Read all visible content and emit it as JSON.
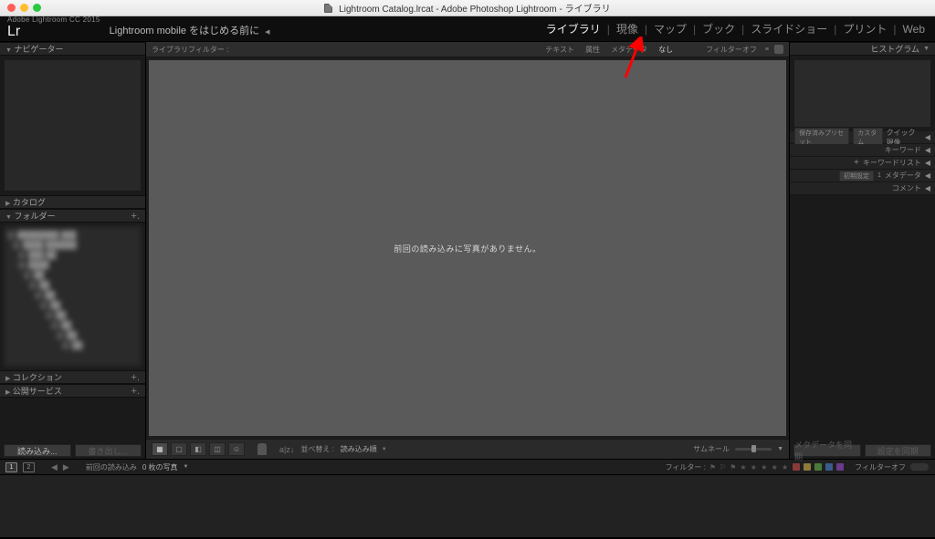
{
  "mac": {
    "title": "Lightroom Catalog.lrcat - Adobe Photoshop Lightroom - ライブラリ"
  },
  "topbar": {
    "edition": "Adobe Lightroom CC 2015",
    "logo": "Lr",
    "tagline": "Lightroom mobile をはじめる前に",
    "triangle": "◀"
  },
  "modules": {
    "library": "ライブラリ",
    "develop": "現像",
    "map": "マップ",
    "book": "ブック",
    "slideshow": "スライドショー",
    "print": "プリント",
    "web": "Web"
  },
  "leftPanel": {
    "navigator": "ナビゲーター",
    "catalog": "カタログ",
    "folders": "フォルダー",
    "collections": "コレクション",
    "publish": "公開サービス",
    "importBtn": "読み込み...",
    "exportBtn": "書き出し..."
  },
  "rightPanel": {
    "histogram": "ヒストグラム",
    "quickDevelop": "クイック現像",
    "savedPreset": "保存済みプリセット",
    "custom": "カスタム",
    "keyword": "キーワード",
    "keywordList": "キーワードリスト",
    "presetLabel": "初期設定",
    "presetCount": "1",
    "metadata": "メタデータ",
    "comments": "コメント",
    "syncMeta": "メタデータを同期",
    "syncSettings": "設定を同期"
  },
  "filterBar": {
    "label": "ライブラリフィルター :",
    "text": "テキスト",
    "attribute": "属性",
    "metadata": "メタデータ",
    "none": "なし",
    "filterOff": "フィルターオフ"
  },
  "canvas": {
    "message": "前回の読み込みに写真がありません。"
  },
  "toolbar": {
    "sortLabel": "並べ替え :",
    "sortValue": "読み込み順",
    "thumbLabel": "サムネール"
  },
  "filmstrip": {
    "monitor1": "1",
    "monitor2": "2",
    "source": "前回の読み込み",
    "count": "0 枚の写真",
    "filterLabel": "フィルター :",
    "filterOff": "フィルターオフ"
  }
}
